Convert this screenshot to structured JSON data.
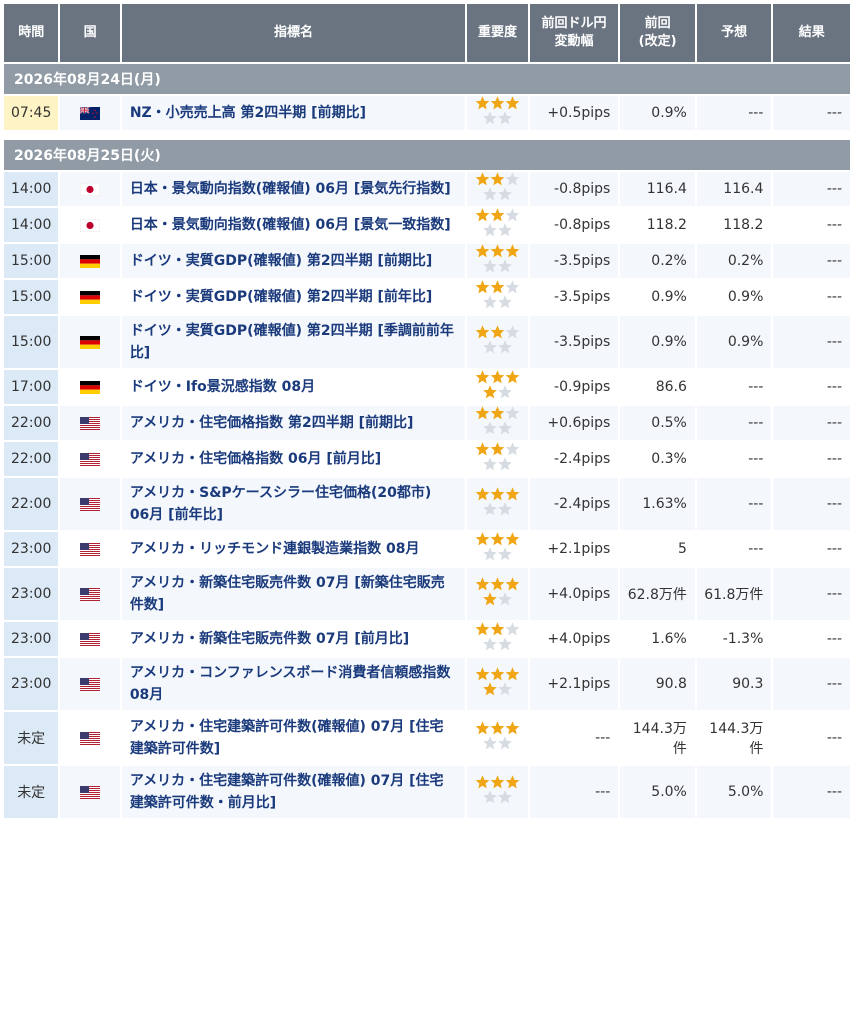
{
  "headers": {
    "time": "時間",
    "country": "国",
    "name": "指標名",
    "importance": "重要度",
    "pips_line1": "前回ドル円",
    "pips_line2": "変動幅",
    "prev_line1": "前回",
    "prev_line2": "(改定)",
    "forecast": "予想",
    "result": "結果"
  },
  "colors": {
    "header_bg": "#6a7480",
    "date_bg": "#909ba6",
    "time_bg": "#dce9f6",
    "time_current_bg": "#fdf3c4",
    "link_text": "#1a3a7c",
    "star_on": "#f0a614",
    "star_off": "#d7dce2"
  },
  "groups": [
    {
      "date": "2026年08月24日(月)",
      "events": [
        {
          "time": "07:45",
          "current": true,
          "country": "nz",
          "country_icon": "new-zealand-flag-icon",
          "name": "NZ・小売売上高 第2四半期 [前期比]",
          "importance": 3,
          "pips": "+0.5pips",
          "previous": "0.9%",
          "forecast": "---",
          "result": "---"
        }
      ]
    },
    {
      "date": "2026年08月25日(火)",
      "events": [
        {
          "time": "14:00",
          "current": false,
          "country": "jp",
          "country_icon": "japan-flag-icon",
          "name": "日本・景気動向指数(確報値) 06月 [景気先行指数]",
          "importance": 2,
          "pips": "-0.8pips",
          "previous": "116.4",
          "forecast": "116.4",
          "result": "---"
        },
        {
          "time": "14:00",
          "current": false,
          "country": "jp",
          "country_icon": "japan-flag-icon",
          "name": "日本・景気動向指数(確報値) 06月 [景気一致指数]",
          "importance": 2,
          "pips": "-0.8pips",
          "previous": "118.2",
          "forecast": "118.2",
          "result": "---"
        },
        {
          "time": "15:00",
          "current": false,
          "country": "de",
          "country_icon": "germany-flag-icon",
          "name": "ドイツ・実質GDP(確報値) 第2四半期 [前期比]",
          "importance": 3,
          "pips": "-3.5pips",
          "previous": "0.2%",
          "forecast": "0.2%",
          "result": "---"
        },
        {
          "time": "15:00",
          "current": false,
          "country": "de",
          "country_icon": "germany-flag-icon",
          "name": "ドイツ・実質GDP(確報値) 第2四半期 [前年比]",
          "importance": 2,
          "pips": "-3.5pips",
          "previous": "0.9%",
          "forecast": "0.9%",
          "result": "---"
        },
        {
          "time": "15:00",
          "current": false,
          "country": "de",
          "country_icon": "germany-flag-icon",
          "name": "ドイツ・実質GDP(確報値) 第2四半期 [季調前前年比]",
          "importance": 2,
          "pips": "-3.5pips",
          "previous": "0.9%",
          "forecast": "0.9%",
          "result": "---"
        },
        {
          "time": "17:00",
          "current": false,
          "country": "de",
          "country_icon": "germany-flag-icon",
          "name": "ドイツ・Ifo景況感指数 08月",
          "importance": 4,
          "pips": "-0.9pips",
          "previous": "86.6",
          "forecast": "---",
          "result": "---"
        },
        {
          "time": "22:00",
          "current": false,
          "country": "us",
          "country_icon": "usa-flag-icon",
          "name": "アメリカ・住宅価格指数 第2四半期 [前期比]",
          "importance": 2,
          "pips": "+0.6pips",
          "previous": "0.5%",
          "forecast": "---",
          "result": "---"
        },
        {
          "time": "22:00",
          "current": false,
          "country": "us",
          "country_icon": "usa-flag-icon",
          "name": "アメリカ・住宅価格指数 06月 [前月比]",
          "importance": 2,
          "pips": "-2.4pips",
          "previous": "0.3%",
          "forecast": "---",
          "result": "---"
        },
        {
          "time": "22:00",
          "current": false,
          "country": "us",
          "country_icon": "usa-flag-icon",
          "name": "アメリカ・S&Pケースシラー住宅価格(20都市) 06月 [前年比]",
          "importance": 3,
          "pips": "-2.4pips",
          "previous": "1.63%",
          "forecast": "---",
          "result": "---"
        },
        {
          "time": "23:00",
          "current": false,
          "country": "us",
          "country_icon": "usa-flag-icon",
          "name": "アメリカ・リッチモンド連銀製造業指数 08月",
          "importance": 3,
          "pips": "+2.1pips",
          "previous": "5",
          "forecast": "---",
          "result": "---"
        },
        {
          "time": "23:00",
          "current": false,
          "country": "us",
          "country_icon": "usa-flag-icon",
          "name": "アメリカ・新築住宅販売件数 07月 [新築住宅販売件数]",
          "importance": 4,
          "pips": "+4.0pips",
          "previous": "62.8万件",
          "forecast": "61.8万件",
          "result": "---"
        },
        {
          "time": "23:00",
          "current": false,
          "country": "us",
          "country_icon": "usa-flag-icon",
          "name": "アメリカ・新築住宅販売件数 07月 [前月比]",
          "importance": 2,
          "pips": "+4.0pips",
          "previous": "1.6%",
          "forecast": "-1.3%",
          "result": "---"
        },
        {
          "time": "23:00",
          "current": false,
          "country": "us",
          "country_icon": "usa-flag-icon",
          "name": "アメリカ・コンファレンスボード消費者信頼感指数 08月",
          "importance": 4,
          "pips": "+2.1pips",
          "previous": "90.8",
          "forecast": "90.3",
          "result": "---"
        },
        {
          "time": "未定",
          "current": false,
          "country": "us",
          "country_icon": "usa-flag-icon",
          "name": "アメリカ・住宅建築許可件数(確報値) 07月 [住宅建築許可件数]",
          "importance": 3,
          "pips": "---",
          "previous": "144.3万件",
          "forecast": "144.3万件",
          "result": "---"
        },
        {
          "time": "未定",
          "current": false,
          "country": "us",
          "country_icon": "usa-flag-icon",
          "name": "アメリカ・住宅建築許可件数(確報値) 07月 [住宅建築許可件数・前月比]",
          "importance": 3,
          "pips": "---",
          "previous": "5.0%",
          "forecast": "5.0%",
          "result": "---"
        }
      ]
    }
  ]
}
